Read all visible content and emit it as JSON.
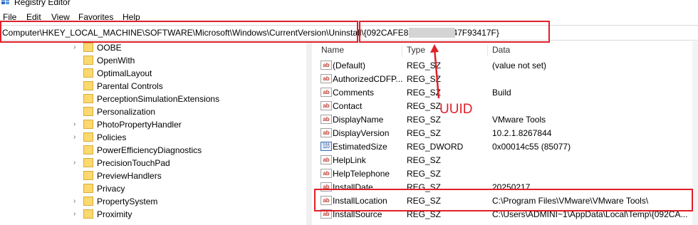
{
  "window": {
    "title": "Registry Editor",
    "icon": "registry-icon"
  },
  "menu": [
    "File",
    "Edit",
    "View",
    "Favorites",
    "Help"
  ],
  "address": {
    "path": "Computer\\HKEY_LOCAL_MACHINE\\SOFTWARE\\Microsoft\\Windows\\CurrentVersion\\Uninstall\\{092CAFE8-7A                C6-A5547F93417F}"
  },
  "annotations": {
    "uuid_label": "UUID",
    "highlight_color": "#e0202a"
  },
  "tree": {
    "items": [
      {
        "label": "OOBE",
        "expandable": true
      },
      {
        "label": "OpenWith",
        "expandable": false
      },
      {
        "label": "OptimalLayout",
        "expandable": false
      },
      {
        "label": "Parental Controls",
        "expandable": false
      },
      {
        "label": "PerceptionSimulationExtensions",
        "expandable": false
      },
      {
        "label": "Personalization",
        "expandable": false
      },
      {
        "label": "PhotoPropertyHandler",
        "expandable": true
      },
      {
        "label": "Policies",
        "expandable": true
      },
      {
        "label": "PowerEfficiencyDiagnostics",
        "expandable": false
      },
      {
        "label": "PrecisionTouchPad",
        "expandable": true
      },
      {
        "label": "PreviewHandlers",
        "expandable": false
      },
      {
        "label": "Privacy",
        "expandable": false
      },
      {
        "label": "PropertySystem",
        "expandable": true
      },
      {
        "label": "Proximity",
        "expandable": true
      }
    ]
  },
  "values": {
    "columns": {
      "name": "Name",
      "type": "Type",
      "data": "Data"
    },
    "rows": [
      {
        "name": "(Default)",
        "type": "REG_SZ",
        "data": "(value not set)",
        "icon": "ab"
      },
      {
        "name": "AuthorizedCDFP...",
        "type": "REG_SZ",
        "data": "",
        "icon": "ab"
      },
      {
        "name": "Comments",
        "type": "REG_SZ",
        "data": "Build",
        "icon": "ab"
      },
      {
        "name": "Contact",
        "type": "REG_SZ",
        "data": "",
        "icon": "ab"
      },
      {
        "name": "DisplayName",
        "type": "REG_SZ",
        "data": "VMware Tools",
        "icon": "ab"
      },
      {
        "name": "DisplayVersion",
        "type": "REG_SZ",
        "data": "10.2.1.8267844",
        "icon": "ab"
      },
      {
        "name": "EstimatedSize",
        "type": "REG_DWORD",
        "data": "0x00014c55 (85077)",
        "icon": "binary"
      },
      {
        "name": "HelpLink",
        "type": "REG_SZ",
        "data": "",
        "icon": "ab"
      },
      {
        "name": "HelpTelephone",
        "type": "REG_SZ",
        "data": "",
        "icon": "ab"
      },
      {
        "name": "InstallDate",
        "type": "REG_SZ",
        "data": "20250217",
        "icon": "ab"
      },
      {
        "name": "InstallLocation",
        "type": "REG_SZ",
        "data": "C:\\Program Files\\VMware\\VMware Tools\\",
        "icon": "ab"
      },
      {
        "name": "InstallSource",
        "type": "REG_SZ",
        "data": "C:\\Users\\ADMINI~1\\AppData\\Local\\Temp\\{092CA...",
        "icon": "ab"
      }
    ]
  }
}
